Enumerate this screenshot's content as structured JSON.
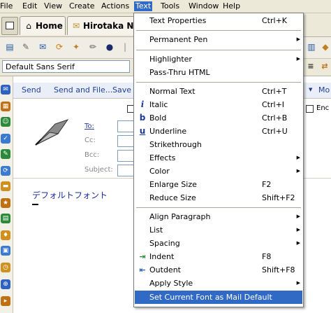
{
  "menubar": {
    "items": [
      {
        "label": "File"
      },
      {
        "label": "Edit"
      },
      {
        "label": "View"
      },
      {
        "label": "Create"
      },
      {
        "label": "Actions"
      },
      {
        "label": "Text"
      },
      {
        "label": "Tools"
      },
      {
        "label": "Window"
      },
      {
        "label": "Help"
      }
    ]
  },
  "tabs": {
    "home_label": "Home",
    "compose_label": "Hirotaka Na"
  },
  "fontbar": {
    "font_value": "Default Sans Serif"
  },
  "actionbar": {
    "send": "Send",
    "send_file": "Send and File...",
    "save": "Save",
    "more": "Mo"
  },
  "header": {
    "to": "To:",
    "cc": "Cc:",
    "bcc": "Bcc:",
    "subject": "Subject:",
    "encrypt": "Enc"
  },
  "body": {
    "text": "デフォルトフォント"
  },
  "text_menu": {
    "items": [
      {
        "label": "Text Properties",
        "shortcut": "Ctrl+K"
      },
      {
        "label": "Permanent Pen",
        "submenu": true
      },
      {
        "label": "Highlighter",
        "submenu": true
      },
      {
        "label": "Pass-Thru HTML"
      },
      {
        "label": "Normal Text",
        "shortcut": "Ctrl+T"
      },
      {
        "label": "Italic",
        "shortcut": "Ctrl+I",
        "icon": "italic-icon"
      },
      {
        "label": "Bold",
        "shortcut": "Ctrl+B",
        "icon": "bold-icon"
      },
      {
        "label": "Underline",
        "shortcut": "Ctrl+U",
        "icon": "underline-icon"
      },
      {
        "label": "Strikethrough"
      },
      {
        "label": "Effects",
        "submenu": true
      },
      {
        "label": "Color",
        "submenu": true
      },
      {
        "label": "Enlarge Size",
        "shortcut": "F2"
      },
      {
        "label": "Reduce Size",
        "shortcut": "Shift+F2"
      },
      {
        "label": "Align Paragraph",
        "submenu": true
      },
      {
        "label": "List",
        "submenu": true
      },
      {
        "label": "Spacing",
        "submenu": true
      },
      {
        "label": "Indent",
        "shortcut": "F8",
        "icon": "indent-icon"
      },
      {
        "label": "Outdent",
        "shortcut": "Shift+F8",
        "icon": "outdent-icon"
      },
      {
        "label": "Apply Style",
        "submenu": true
      },
      {
        "label": "Set Current Font as Mail Default",
        "highlighted": true
      }
    ]
  },
  "colors": {
    "menu_highlight": "#316ac5",
    "chrome": "#ece9d8",
    "link_blue": "#2a3ea0"
  }
}
